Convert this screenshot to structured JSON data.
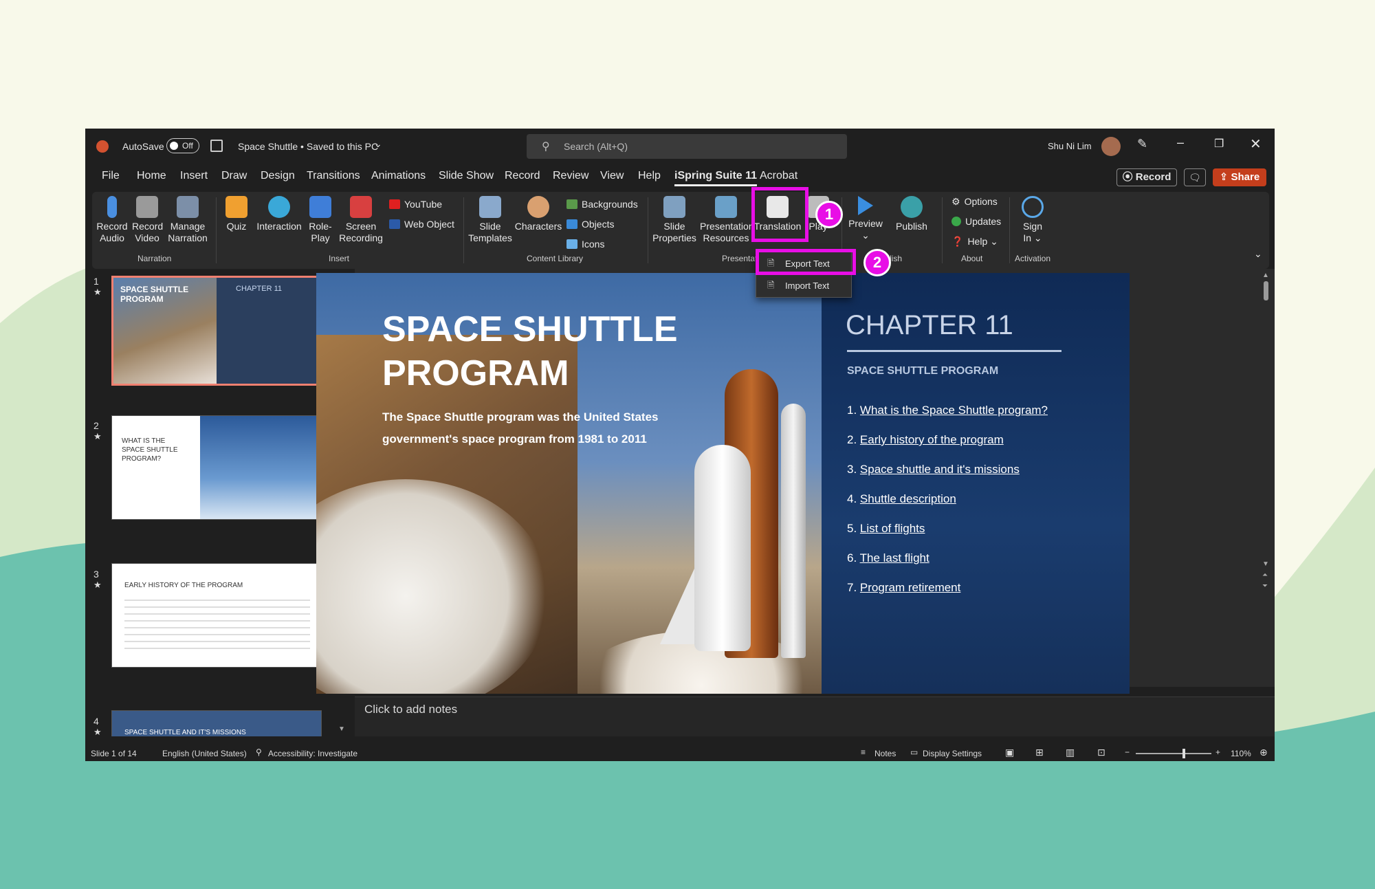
{
  "titlebar": {
    "autosave_label": "AutoSave",
    "autosave_state": "Off",
    "doc_title": "Space Shuttle • Saved to this PC",
    "search_placeholder": "Search (Alt+Q)",
    "user_name": "Shu Ni Lim"
  },
  "tabs": [
    "File",
    "Home",
    "Insert",
    "Draw",
    "Design",
    "Transitions",
    "Animations",
    "Slide Show",
    "Record",
    "Review",
    "View",
    "Help",
    "iSpring Suite 11",
    "Acrobat"
  ],
  "right_buttons": {
    "record": "Record",
    "share": "Share"
  },
  "ribbon": {
    "narration": {
      "group": "Narration",
      "record_audio": [
        "Record",
        "Audio"
      ],
      "record_video": [
        "Record",
        "Video"
      ],
      "manage_narration": [
        "Manage",
        "Narration"
      ]
    },
    "insert": {
      "group": "Insert",
      "quiz": "Quiz",
      "interaction": "Interaction",
      "role_play": [
        "Role-",
        "Play"
      ],
      "screen_recording": [
        "Screen",
        "Recording"
      ],
      "youtube": "YouTube",
      "web_object": "Web Object"
    },
    "content_library": {
      "group": "Content Library",
      "slide_templates": [
        "Slide",
        "Templates"
      ],
      "characters": "Characters",
      "backgrounds": "Backgrounds",
      "objects": "Objects",
      "icons": "Icons"
    },
    "presentation": {
      "group": "Presentati",
      "slide_properties": [
        "Slide",
        "Properties"
      ],
      "presentation_resources": [
        "Presentation",
        "Resources"
      ],
      "translation": "Translation",
      "player": "Play"
    },
    "publish": {
      "group": "lish",
      "preview": "Preview",
      "publish": "Publish"
    },
    "about": {
      "group": "About",
      "options": "Options",
      "updates": "Updates",
      "help": "Help"
    },
    "activation": {
      "group": "Activation",
      "sign_in": [
        "Sign",
        "In"
      ]
    }
  },
  "translation_menu": {
    "export_text": "Export Text",
    "import_text": "Import Text"
  },
  "badges": [
    "1",
    "2"
  ],
  "thumbnails": [
    {
      "num": "1",
      "title": "SPACE SHUTTLE PROGRAM",
      "chapter": "CHAPTER 11"
    },
    {
      "num": "2",
      "title": "WHAT IS THE SPACE SHUTTLE PROGRAM?"
    },
    {
      "num": "3",
      "title": "EARLY HISTORY OF THE PROGRAM"
    },
    {
      "num": "4",
      "title": "SPACE SHUTTLE AND IT'S MISSIONS"
    }
  ],
  "slide": {
    "title_line1": "SPACE SHUTTLE",
    "title_line2": "PROGRAM",
    "subtitle_line1": "The Space Shuttle program was the United States",
    "subtitle_line2": "government's space program from 1981 to 2011",
    "chapter": "CHAPTER 11",
    "section": "SPACE SHUTTLE PROGRAM",
    "toc": [
      {
        "n": "1.",
        "t": "What is the Space Shuttle program?"
      },
      {
        "n": "2.",
        "t": "Early history of the program"
      },
      {
        "n": "3.",
        "t": "Space shuttle and it's missions"
      },
      {
        "n": "4.",
        "t": "Shuttle description"
      },
      {
        "n": "5.",
        "t": "List of flights"
      },
      {
        "n": "6.",
        "t": "The last flight"
      },
      {
        "n": "7.",
        "t": "Program retirement"
      }
    ]
  },
  "notes_placeholder": "Click to add notes",
  "status": {
    "slide_count": "Slide 1 of 14",
    "language": "English (United States)",
    "accessibility": "Accessibility: Investigate",
    "notes": "Notes",
    "display_settings": "Display Settings",
    "zoom": "110%"
  },
  "colors": {
    "accent_highlight": "#e80ee6",
    "share_button": "#c43e1c",
    "app_bg": "#1f1f1f",
    "ribbon_bg": "#2b2b2b"
  }
}
